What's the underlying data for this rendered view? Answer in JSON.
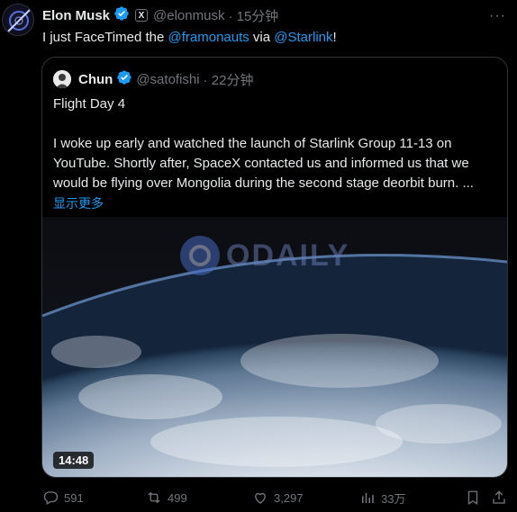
{
  "author": {
    "name": "Elon Musk",
    "handle": "@elonmusk",
    "time": "· 15分钟",
    "badge": "X"
  },
  "tweet": {
    "text_before": "I just FaceTimed the ",
    "mention_1": "@framonauts",
    "text_middle": " via ",
    "mention_2": "@Starlink",
    "text_after": "!"
  },
  "quote": {
    "name": "Chun",
    "handle": "@satofishi",
    "time": "· 22分钟",
    "line_title": "Flight Day 4",
    "line_1": "I woke up early and watched the launch of Starlink Group 11-13 on",
    "line_2": "YouTube. Shortly after, SpaceX contacted us and informed us that we",
    "line_3": "would be flying over Mongolia during the second stage deorbit burn. ...",
    "show_more": "显示更多",
    "video_duration": "14:48",
    "watermark": "ODAILY"
  },
  "actions": {
    "replies": "591",
    "retweets": "499",
    "likes": "3,297",
    "views": "33万"
  },
  "colors": {
    "accent": "#1d9bf0",
    "muted": "#71767b",
    "border": "#2f3336",
    "background": "#000000"
  },
  "icons": [
    "more-icon",
    "verified-icon",
    "reply-icon",
    "retweet-icon",
    "like-icon",
    "views-icon",
    "bookmark-icon",
    "share-icon"
  ]
}
